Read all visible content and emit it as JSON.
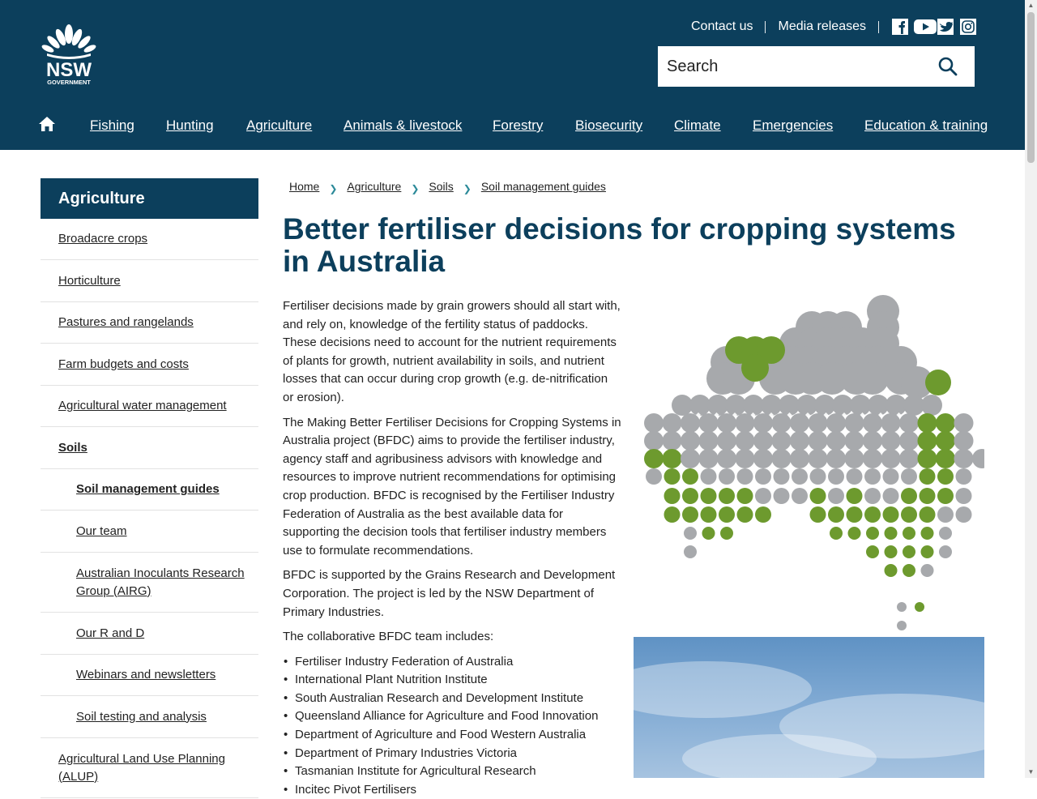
{
  "header": {
    "logo_text": "NSW",
    "logo_subtext": "GOVERNMENT",
    "contact_label": "Contact us",
    "media_label": "Media releases",
    "social_icons": [
      "facebook-icon",
      "youtube-icon",
      "twitter-icon",
      "instagram-icon"
    ],
    "search_placeholder": "Search"
  },
  "nav": {
    "items": [
      "Fishing",
      "Hunting",
      "Agriculture",
      "Animals & livestock",
      "Forestry",
      "Biosecurity",
      "Climate",
      "Emergencies",
      "Education & training"
    ]
  },
  "sidebar": {
    "heading": "Agriculture",
    "items": [
      {
        "label": "Broadacre crops"
      },
      {
        "label": "Horticulture"
      },
      {
        "label": "Pastures and rangelands"
      },
      {
        "label": "Farm budgets and costs"
      },
      {
        "label": "Agricultural water management"
      },
      {
        "label": "Soils"
      },
      {
        "label": "Soil management guides"
      },
      {
        "label": "Our team"
      },
      {
        "label": "Australian Inoculants Research Group (AIRG)"
      },
      {
        "label": "Our R and D"
      },
      {
        "label": "Webinars and newsletters"
      },
      {
        "label": "Soil testing and analysis"
      },
      {
        "label": "Agricultural Land Use Planning (ALUP)"
      }
    ]
  },
  "breadcrumb": [
    "Home",
    "Agriculture",
    "Soils",
    "Soil management guides"
  ],
  "main": {
    "title": "Better fertiliser decisions for cropping systems in Australia",
    "paragraphs": [
      "Fertiliser decisions made by grain growers should all start with, and rely on, knowledge of the fertility status of paddocks. These decisions need to account for the nutrient requirements of plants for growth, nutrient availability in soils, and nutrient losses that can occur during crop growth (e.g. de-nitrification or erosion).",
      "The Making Better Fertiliser Decisions for Cropping Systems in Australia project (BFDC) aims to provide the fertiliser industry, agency staff and agribusiness advisors with knowledge and resources to improve nutrient recommendations for optimising crop production. BFDC is recognised by the Fertiliser Industry Federation of Australia as the best available data for supporting the decision tools that fertiliser industry members use to formulate recommendations.",
      "BFDC is supported by the Grains Research and Development Corporation. The project is led by the NSW Department of Primary Industries.",
      "The collaborative BFDC team includes:"
    ],
    "team": [
      "Fertiliser Industry Federation of Australia",
      "International Plant Nutrition Institute",
      "South Australian Research and Development Institute",
      "Queensland Alliance for Agriculture and Food Innovation",
      "Department of Agriculture and Food Western Australia",
      "Department of Primary Industries Victoria",
      "Tasmanian Institute for Agricultural Research",
      "Incitec Pivot Fertilisers"
    ]
  },
  "colors": {
    "brand_navy": "#0c3f5c",
    "map_grey": "#a7a9ac",
    "map_green": "#6d9a2e",
    "breadcrumb_chevron": "#2c8a99"
  }
}
